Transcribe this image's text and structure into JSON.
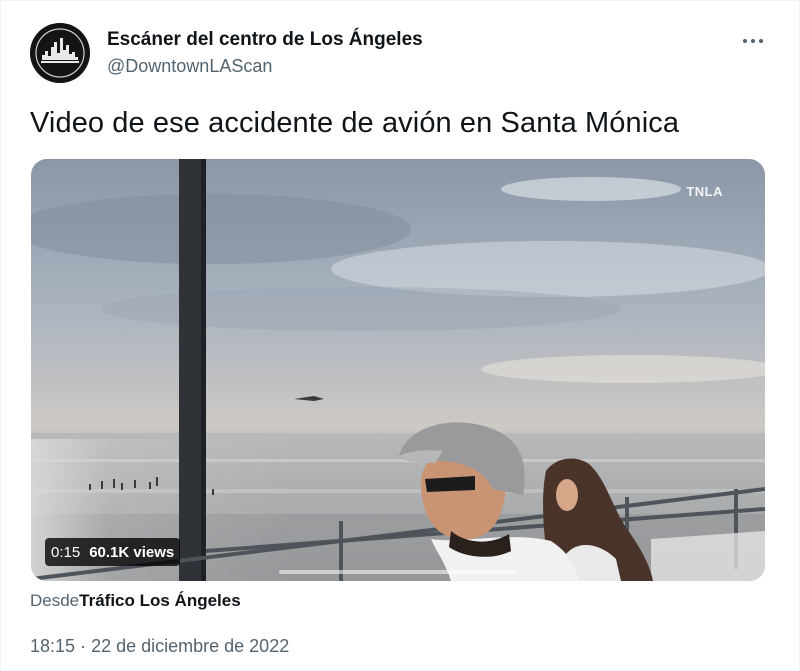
{
  "tweet": {
    "author": {
      "display_name": "Escáner del centro de Los Ángeles",
      "handle": "@DowntownLAScan"
    },
    "more_icon": "more-horizontal-icon",
    "text": "Video de ese accidente de avión en Santa Mónica",
    "media": {
      "watermark": "TNLA",
      "duration": "0:15",
      "views": "60.1K views",
      "progress": 0.0
    },
    "source": {
      "prefix": "Desde",
      "name": "Tráfico Los Ángeles"
    },
    "time": "18:15",
    "separator": "·",
    "date": "22 de diciembre de 2022"
  }
}
